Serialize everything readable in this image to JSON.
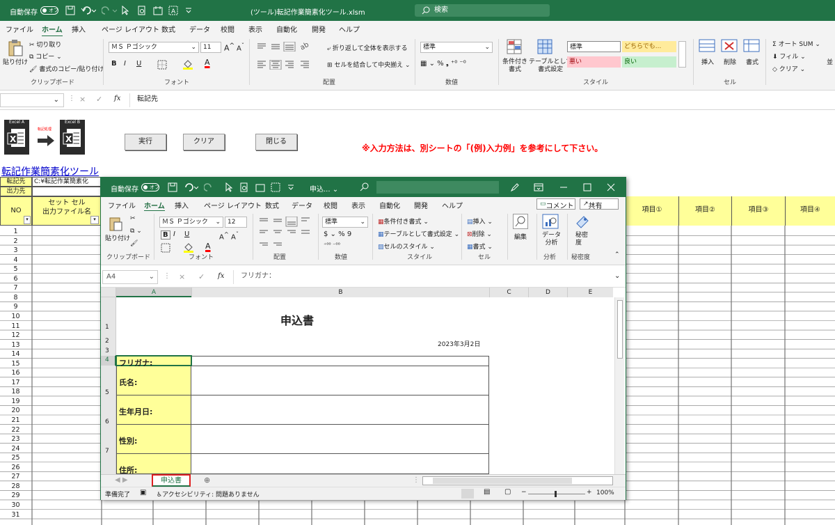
{
  "main": {
    "autosave_label": "自動保存",
    "autosave_state": "オフ",
    "title": "(ツール)転記作業簡素化ツール.xlsm",
    "search_placeholder": "検索",
    "tabs": [
      "ファイル",
      "ホーム",
      "挿入",
      "ページ レイアウト",
      "数式",
      "データ",
      "校閲",
      "表示",
      "自動化",
      "開発",
      "ヘルプ"
    ],
    "clipboard": {
      "paste": "貼り付け",
      "cut": "切り取り",
      "copy": "コピー",
      "format_painter": "書式のコピー/貼り付け",
      "group": "クリップボード"
    },
    "font": {
      "name": "ＭＳ Ｐゴシック",
      "size": "11",
      "group": "フォント",
      "bold": "B",
      "italic": "I",
      "underline": "U",
      "font_color_letter": "A"
    },
    "align": {
      "wrap": "折り返して全体を表示する",
      "merge": "セルを結合して中央揃え",
      "group": "配置"
    },
    "number": {
      "format": "標準",
      "group": "数値"
    },
    "styles": {
      "conditional": "条件付き\n書式",
      "table": "テーブルとして\n書式設定",
      "normal": "標準",
      "neutral": "どちらでも...",
      "bad": "悪い",
      "good": "良い",
      "group": "スタイル"
    },
    "cells": {
      "insert": "挿入",
      "delete": "削除",
      "format": "書式",
      "group": "セル"
    },
    "editing": {
      "autosum": "オート SUM",
      "fill": "フィル",
      "clear": "クリア",
      "sort": "並"
    },
    "fbar": {
      "fx": "fx",
      "value": "転記先",
      "cancel": "×",
      "enter": "✓"
    }
  },
  "sheet": {
    "logo_a": "Excel A",
    "logo_mid": "転記処理",
    "logo_b": "Excel B",
    "buttons": {
      "run": "実行",
      "clear": "クリア",
      "close": "閉じる"
    },
    "notice": "※入力方法は、別シートの「(例)入力例」を参考にして下さい。",
    "tool_title": "転記作業簡素化ツール",
    "dest_label": "転記先",
    "dest_path": "C:¥転記作業簡素化",
    "output_label": "出力先",
    "headers": {
      "no": "NO",
      "set_cell": "セット セル",
      "out_file": "出力ファイル名",
      "items": [
        "項目①",
        "項目②",
        "項目③",
        "項目④"
      ]
    },
    "rows": [
      "1",
      "2",
      "3",
      "4",
      "5",
      "6",
      "7",
      "8",
      "9",
      "10",
      "11",
      "12",
      "13",
      "14",
      "15",
      "16",
      "17",
      "18",
      "19",
      "20",
      "21",
      "22",
      "23",
      "24",
      "25",
      "26",
      "27",
      "28",
      "29",
      "30",
      "31"
    ]
  },
  "win": {
    "autosave_label": "自動保存",
    "autosave_state": "オフ",
    "title": "申込...",
    "tabs": [
      "ファイル",
      "ホーム",
      "挿入",
      "ページ レイアウト",
      "数式",
      "データ",
      "校閲",
      "表示",
      "自動化",
      "開発",
      "ヘルプ"
    ],
    "comment": "コメント",
    "share": "共有",
    "clipboard": {
      "paste": "貼り付け",
      "group": "クリップボード"
    },
    "font": {
      "name": "ＭＳ Ｐゴシック",
      "size": "12",
      "group": "フォント",
      "bold": "B",
      "italic": "I",
      "underline": "U",
      "font_color_letter": "A"
    },
    "align_group": "配置",
    "number": {
      "format": "標準",
      "group": "数値",
      "percent": "%",
      "comma": "9"
    },
    "styles": {
      "conditional": "条件付き書式",
      "table": "テーブルとして書式設定",
      "cell": "セルのスタイル",
      "group": "スタイル"
    },
    "cells": {
      "insert": "挿入",
      "delete": "削除",
      "format": "書式",
      "group": "セル"
    },
    "editing": "編集",
    "analysis": "データ\n分析",
    "analysis_group": "分析",
    "sensitivity": "秘密\n度",
    "sensitivity_group": "秘密度",
    "namebox": "A4",
    "fx": "fx",
    "formula": "フリガナ：",
    "cols": [
      "A",
      "B",
      "C",
      "D",
      "E"
    ],
    "form": {
      "title": "申込書",
      "date": "2023年3月2日",
      "furigana": "フリガナ:",
      "name": "氏名:",
      "birth": "生年月日:",
      "gender": "性別:",
      "address": "住所:"
    },
    "rownums": [
      "1",
      "2",
      "3",
      "4",
      "5",
      "6",
      "7"
    ],
    "sheet_tab": "申込書",
    "status": "準備完了",
    "accessibility": "アクセシビリティ: 問題ありません",
    "zoom": "100%"
  },
  "colors": {
    "excel_green": "#217346",
    "yellow": "#ffff99",
    "notice_red": "#ff0000",
    "bad_bg": "#ffc7ce",
    "good_bg": "#c6efce",
    "neutral_bg": "#ffeb9c"
  }
}
